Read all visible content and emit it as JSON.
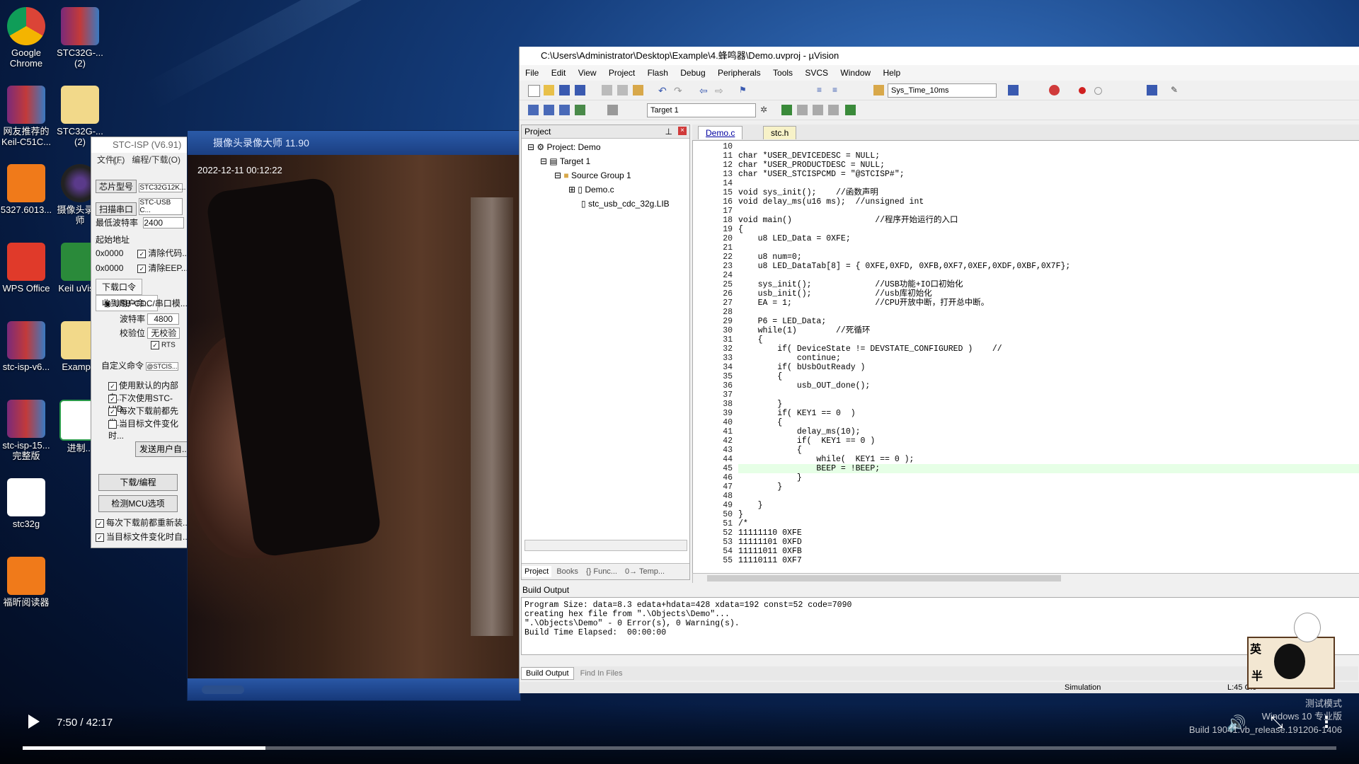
{
  "desktop": {
    "icons": [
      {
        "label": "Google\nChrome",
        "icon": "chrome-icon"
      },
      {
        "label": "STC32G-...\n(2)",
        "icon": "winrar-icon"
      },
      {
        "label": "网友推荐的\nKeil-C51C...",
        "icon": "winrar-icon"
      },
      {
        "label": "STC32G-...\n(2)",
        "icon": "folder-icon"
      },
      {
        "label": "5327.6013...",
        "icon": "pdf-icon"
      },
      {
        "label": "摄像头录像\n师",
        "icon": "camera-icon"
      },
      {
        "label": "WPS Office",
        "icon": "wps-icon"
      },
      {
        "label": "Keil uVis...",
        "icon": "keil-icon"
      },
      {
        "label": "stc-isp-v6...",
        "icon": "winrar-icon"
      },
      {
        "label": "Examp...",
        "icon": "folder-icon"
      },
      {
        "label": "stc-isp-15...\n完整版",
        "icon": "winrar-icon"
      },
      {
        "label": "进制...",
        "icon": "sheet-icon"
      },
      {
        "label": "stc32g",
        "icon": "doc-icon"
      },
      {
        "label": "福昕阅读器",
        "icon": "pdf-icon"
      }
    ]
  },
  "camera_window": {
    "title": "摄像头录像大师 11.90",
    "timestamp": "2022-12-11 00:12:22"
  },
  "stc_window": {
    "title": "STC-ISP (V6.91) (...",
    "menu": [
      "文件(F)",
      "编程/下载(O)"
    ],
    "chip_label": "芯片型号",
    "chip_value": "STC32G12K...",
    "port_label": "扫描串口",
    "port_value": "STC-USB C...",
    "baud_min_label": "最低波特率",
    "baud_min_value": "2400",
    "start_addr_label": "起始地址",
    "addr1": "0x0000",
    "addr1_chk": "清除代码...",
    "addr2": "0x0000",
    "addr2_chk": "清除EEP...",
    "tabs": [
      "下载口令",
      "收到用户命..."
    ],
    "radio_label": "USB-CDC/串口模...",
    "baud_label": "波特率",
    "baud_value": "4800",
    "parity_label": "校验位",
    "parity_value": "无校验",
    "rts_label": "RTS",
    "custom_cmd_label": "自定义命令",
    "custom_cmd_value": "@STCIS...",
    "options": [
      "使用默认的内部自...",
      "下次使用STC-HID...",
      "每次下载前都先发...",
      "当目标文件变化时..."
    ],
    "send_button": "发送用户自...",
    "download_button": "下载/编程",
    "check_button": "检测MCU选项",
    "bottom_opts": [
      "每次下载前都重新装...",
      "当目标文件变化时自..."
    ]
  },
  "uvision": {
    "title": "C:\\Users\\Administrator\\Desktop\\Example\\4.蜂鸣器\\Demo.uvproj - µVision",
    "menu": [
      "File",
      "Edit",
      "View",
      "Project",
      "Flash",
      "Debug",
      "Peripherals",
      "Tools",
      "SVCS",
      "Window",
      "Help"
    ],
    "toolbar_combo": "Sys_Time_10ms",
    "target_combo": "Target 1",
    "project_panel_title": "Project",
    "tree": [
      "Project: Demo",
      "Target 1",
      "Source Group 1",
      "Demo.c",
      "stc_usb_cdc_32g.LIB"
    ],
    "bottom_tabs": [
      "Project",
      "Books",
      "{} Func...",
      "0→ Temp..."
    ],
    "editor_tabs": [
      "Demo.c",
      "stc.h"
    ],
    "code_lines": [
      {
        "n": "10",
        "t": ""
      },
      {
        "n": "11",
        "t": "char *USER_DEVICEDESC = NULL;"
      },
      {
        "n": "12",
        "t": "char *USER_PRODUCTDESC = NULL;"
      },
      {
        "n": "13",
        "t": "char *USER_STCISPCMD = \"@STCISP#\";"
      },
      {
        "n": "14",
        "t": ""
      },
      {
        "n": "15",
        "t": "void sys_init();    //函数声明"
      },
      {
        "n": "16",
        "t": "void delay_ms(u16 ms);  //unsigned int"
      },
      {
        "n": "17",
        "t": ""
      },
      {
        "n": "18",
        "t": "void main()                 //程序开始运行的入口"
      },
      {
        "n": "19",
        "t": "{"
      },
      {
        "n": "20",
        "t": "    u8 LED_Data = 0XFE;"
      },
      {
        "n": "21",
        "t": ""
      },
      {
        "n": "22",
        "t": "    u8 num=0;"
      },
      {
        "n": "23",
        "t": "    u8 LED_DataTab[8] = { 0XFE,0XFD, 0XFB,0XF7,0XEF,0XDF,0XBF,0X7F};"
      },
      {
        "n": "24",
        "t": ""
      },
      {
        "n": "25",
        "t": "    sys_init();             //USB功能+IO口初始化"
      },
      {
        "n": "26",
        "t": "    usb_init();             //usb库初始化"
      },
      {
        "n": "27",
        "t": "    EA = 1;                 //CPU开放中断，打开总中断。"
      },
      {
        "n": "28",
        "t": ""
      },
      {
        "n": "29",
        "t": "    P6 = LED_Data;"
      },
      {
        "n": "30",
        "t": "    while(1)        //死循环"
      },
      {
        "n": "31",
        "t": "    {"
      },
      {
        "n": "32",
        "t": "        if( DeviceState != DEVSTATE_CONFIGURED )    //"
      },
      {
        "n": "33",
        "t": "            continue;"
      },
      {
        "n": "34",
        "t": "        if( bUsbOutReady )"
      },
      {
        "n": "35",
        "t": "        {"
      },
      {
        "n": "36",
        "t": "            usb_OUT_done();"
      },
      {
        "n": "37",
        "t": ""
      },
      {
        "n": "38",
        "t": "        }"
      },
      {
        "n": "39",
        "t": "        if( KEY1 == 0  )"
      },
      {
        "n": "40",
        "t": "        {"
      },
      {
        "n": "41",
        "t": "            delay_ms(10);"
      },
      {
        "n": "42",
        "t": "            if(  KEY1 == 0 )"
      },
      {
        "n": "43",
        "t": "            {"
      },
      {
        "n": "44",
        "t": "                while(  KEY1 == 0 );"
      },
      {
        "n": "45",
        "t": "                BEEP = !BEEP;"
      },
      {
        "n": "46",
        "t": "            }"
      },
      {
        "n": "47",
        "t": "        }"
      },
      {
        "n": "48",
        "t": ""
      },
      {
        "n": "49",
        "t": "    }"
      },
      {
        "n": "50",
        "t": "}"
      },
      {
        "n": "51",
        "t": "/*"
      },
      {
        "n": "52",
        "t": "11111110 0XFE"
      },
      {
        "n": "53",
        "t": "11111101 0XFD"
      },
      {
        "n": "54",
        "t": "11111011 0XFB"
      },
      {
        "n": "55",
        "t": "11110111 0XF7"
      }
    ],
    "build_output_title": "Build Output",
    "build_lines": [
      "Program Size: data=8.3 edata+hdata=428 xdata=192 const=52 code=7090",
      "creating hex file from \".\\Objects\\Demo\"...",
      "\".\\Objects\\Demo\" - 0 Error(s), 0 Warning(s).",
      "Build Time Elapsed:  00:00:00"
    ],
    "build_tabs": [
      "Build Output",
      "Find In Files"
    ],
    "status_sim": "Simulation",
    "status_pos": "L:45 C:9"
  },
  "video": {
    "time": "7:50 / 42:17",
    "progress": 0.185
  },
  "watermark": {
    "line1": "测试模式",
    "line2": "Windows 10 专业版",
    "line3": "Build 19041.vb_release.191206-1406"
  },
  "ime": {
    "char1": "英",
    "char2": "半"
  }
}
